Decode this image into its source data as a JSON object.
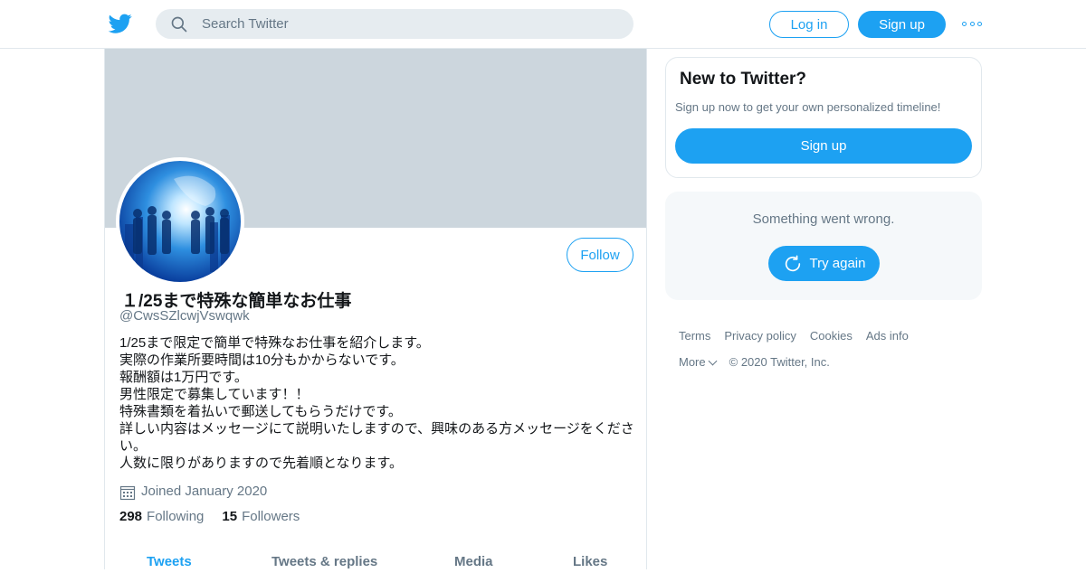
{
  "header": {
    "search_placeholder": "Search Twitter",
    "login_label": "Log in",
    "signup_label": "Sign up",
    "logo_icon": "twitter-bird-icon",
    "more_icon": "more-dots-icon"
  },
  "profile": {
    "display_name": "１/25まで特殊な簡単なお仕事",
    "handle": "@CwsSZlcwjVswqwk",
    "follow_label": "Follow",
    "bio_lines": [
      "1/25まで限定で簡単で特殊なお仕事を紹介します。",
      "実際の作業所要時間は10分もかからないです。",
      "報酬額は1万円です。",
      "男性限定で募集しています！！",
      "特殊書類を着払いで郵送してもらうだけです。",
      "詳しい内容はメッセージにて説明いたしますので、興味のある方メッセージをください。",
      "人数に限りがありますので先着順となります。"
    ],
    "joined": "Joined January 2020",
    "following_count": "298",
    "following_label": "Following",
    "followers_count": "15",
    "followers_label": "Followers"
  },
  "tabs": [
    {
      "label": "Tweets",
      "active": true
    },
    {
      "label": "Tweets & replies",
      "active": false
    },
    {
      "label": "Media",
      "active": false
    },
    {
      "label": "Likes",
      "active": false
    }
  ],
  "sidebar": {
    "new_title": "New to Twitter?",
    "new_text": "Sign up now to get your own personalized timeline!",
    "signup_label": "Sign up",
    "error_text": "Something went wrong.",
    "retry_label": "Try again",
    "footer": {
      "terms": "Terms",
      "privacy": "Privacy policy",
      "cookies": "Cookies",
      "ads": "Ads info",
      "more": "More",
      "copyright": "© 2020 Twitter, Inc."
    }
  },
  "colors": {
    "accent": "#1da1f2",
    "banner": "#ccd6dd",
    "secondary_text": "#657786"
  }
}
